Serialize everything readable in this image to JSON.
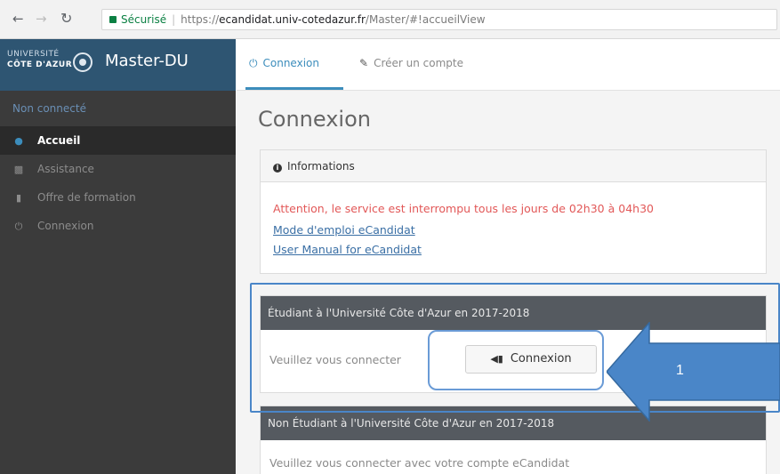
{
  "browser": {
    "back_icon": "arrow-left-icon",
    "forward_icon": "arrow-right-icon",
    "reload_icon": "reload-icon",
    "lock_icon": "lock-icon",
    "secure_label": "Sécurisé",
    "url_protocol": "https://",
    "url_host": "ecandidat.univ-cotedazur.fr",
    "url_path": "/Master/#!accueilView"
  },
  "sidebar": {
    "logo_line1": "UNIVERSITÉ",
    "logo_line2": "CÔTE D'AZUR",
    "app_title": "Master-DU",
    "status": "Non connecté",
    "items": [
      {
        "label": "Accueil",
        "icon": "home-icon",
        "active": true
      },
      {
        "label": "Assistance",
        "icon": "support-icon",
        "active": false
      },
      {
        "label": "Offre de formation",
        "icon": "bookmark-icon",
        "active": false
      },
      {
        "label": "Connexion",
        "icon": "power-icon",
        "active": false
      }
    ]
  },
  "tabs": [
    {
      "label": "Connexion",
      "icon": "power-icon",
      "active": true
    },
    {
      "label": "Créer un compte",
      "icon": "pencil-icon",
      "active": false
    }
  ],
  "main": {
    "heading": "Connexion",
    "info_panel": {
      "title": "Informations",
      "warning": "Attention, le service est interrompu tous les jours de 02h30 à 04h30",
      "link1": "Mode d'emploi eCandidat",
      "link2": "User Manual for eCandidat"
    },
    "student_panel": {
      "title": "Étudiant à l'Université Côte d'Azur en 2017-2018",
      "prompt": "Veuillez vous connecter",
      "button_label": "Connexion"
    },
    "non_student_panel": {
      "title": "Non Étudiant à l'Université Côte d'Azur en 2017-2018",
      "prompt": "Veuillez vous connecter avec votre compte eCandidat"
    }
  },
  "annotation": {
    "step_number": "1",
    "color": "#4a86c8"
  }
}
